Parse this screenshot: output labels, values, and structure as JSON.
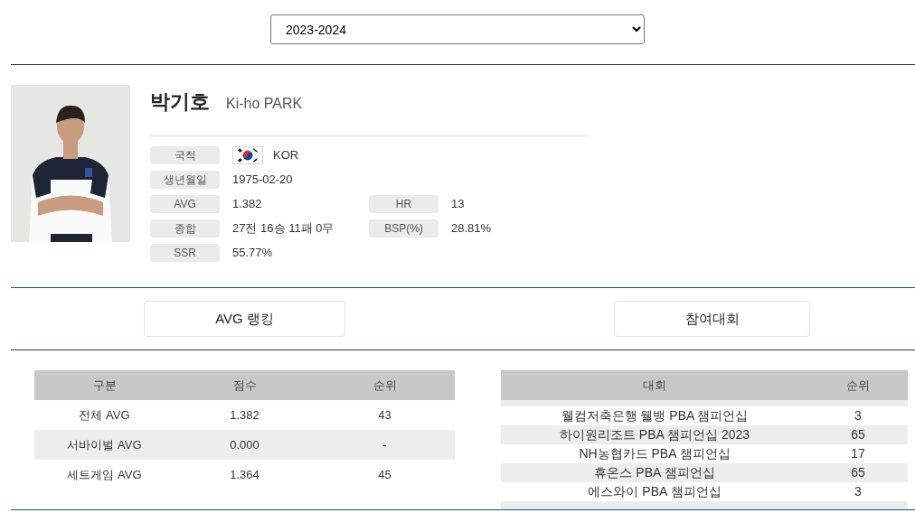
{
  "season_select": {
    "value": "2023-2024"
  },
  "player": {
    "name_ko": "박기호",
    "name_en": "Ki-ho PARK",
    "fields": [
      {
        "label": "국적",
        "value": "KOR",
        "kind": "flag"
      },
      {
        "label": "생년월일",
        "value": "1975-02-20",
        "kind": "text"
      }
    ],
    "stat_pairs": [
      {
        "label": "AVG",
        "value": "1.382",
        "label2": "HR",
        "value2": "13"
      },
      {
        "label": "종합",
        "value": "27전 16승 11패 0무",
        "label2": "BSP(%)",
        "value2": "28.81%"
      }
    ],
    "last_field": {
      "label": "SSR",
      "value": "55.77%"
    }
  },
  "buttons": [
    "AVG 랭킹",
    "참여대회"
  ],
  "ranking_table": {
    "columns": [
      "구분",
      "점수",
      "순위"
    ],
    "rows": [
      [
        "전체 AVG",
        "1.382",
        "43"
      ],
      [
        "서바이벌 AVG",
        "0.000",
        "-"
      ],
      [
        "세트게임 AVG",
        "1.364",
        "45"
      ]
    ]
  },
  "tournament_table": {
    "columns": [
      "대회",
      "순위"
    ],
    "rows": [
      [
        "웰컴저축은행 웰뱅 PBA 챔피언십",
        "3"
      ],
      [
        "하이원리조트 PBA 챔피언십 2023",
        "65"
      ],
      [
        "NH농협카드 PBA 챔피언십",
        "17"
      ],
      [
        "휴온스 PBA 챔피언십",
        "65"
      ],
      [
        "에스와이 PBA 챔피언십",
        "3"
      ]
    ]
  }
}
